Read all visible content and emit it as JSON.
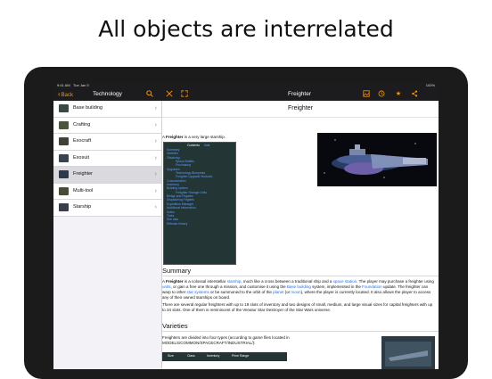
{
  "headline": "All objects are interrelated",
  "status": {
    "time": "9:41 AM",
    "date": "Tue Jan 9",
    "battery": "100%"
  },
  "nav": {
    "back": "Back",
    "left_title": "Technology",
    "right_title": "Freighter"
  },
  "sidebar": {
    "items": [
      {
        "label": "Base building"
      },
      {
        "label": "Crafting"
      },
      {
        "label": "Exocraft"
      },
      {
        "label": "Exosuit"
      },
      {
        "label": "Freighter",
        "selected": true
      },
      {
        "label": "Multi-tool"
      },
      {
        "label": "Starship"
      }
    ]
  },
  "article": {
    "title": "Freighter",
    "intro_pre": "A ",
    "intro_bold": "Freighter",
    "intro_post": " is a very large starship.",
    "toc": {
      "title": "Contents",
      "hide": "hide",
      "items": [
        {
          "text": "Summary",
          "level": 1
        },
        {
          "text": "Varieties",
          "level": 1
        },
        {
          "text": "Obtaining",
          "level": 1
        },
        {
          "text": "Space Battles",
          "level": 2
        },
        {
          "text": "Purchasing",
          "level": 2
        },
        {
          "text": "Upgrades",
          "level": 1
        },
        {
          "text": "Technology Blueprints",
          "level": 2
        },
        {
          "text": "Freighter Upgrade Modules",
          "level": 2
        },
        {
          "text": "Customization",
          "level": 1
        },
        {
          "text": "Inventory",
          "level": 1
        },
        {
          "text": "Building options",
          "level": 1
        },
        {
          "text": "Freighter Storage Units",
          "level": 2
        },
        {
          "text": "Bridge and Frigates",
          "level": 1
        },
        {
          "text": "Dispatching Frigates",
          "level": 1
        },
        {
          "text": "Expedition Manager",
          "level": 1
        },
        {
          "text": "Additional information",
          "level": 1
        },
        {
          "text": "Notes",
          "level": 1
        },
        {
          "text": "Trivia",
          "level": 1
        },
        {
          "text": "See also",
          "level": 1
        },
        {
          "text": "Release history",
          "level": 1
        }
      ]
    },
    "summary_heading": "Summary",
    "summary": {
      "a": "A ",
      "b": "Freighter",
      "c": " is a colossal interstellar ",
      "d": "starship",
      "e": ", much like a cross between a traditional ship and a ",
      "f": "space station",
      "g": ". The player may purchase a freighter using ",
      "h": "units",
      "i": ", or gain a free one through a mission, and customise it using the ",
      "j": "Base building",
      "k": " system, implemented in the ",
      "l": "Foundation",
      "m": " update. The freighter can warp to other ",
      "n": "star systems",
      "o": " or be summoned to the orbit of the ",
      "p": "planet",
      "q": " (or ",
      "r": "moon",
      "s": "), where the player is currently located. It also allows the player to access any of their owned starships on board."
    },
    "summary2": "There are several regular freighters with up to 19 slots of inventory and two designs of small, medium, and large visual sizes for capital freighters with up to 34 slots. One of them is reminiscent of the Venator Star Destroyer of the Star Wars universe.",
    "varieties_heading": "Varieties",
    "varieties_p": "Freighters are divided into four types (according to game files located in MODELS/COMMON/SPACECRAFT/INDUSTRIAL/):",
    "table_headers": [
      "Size",
      "Class",
      "Inventory",
      "Price Range"
    ]
  }
}
